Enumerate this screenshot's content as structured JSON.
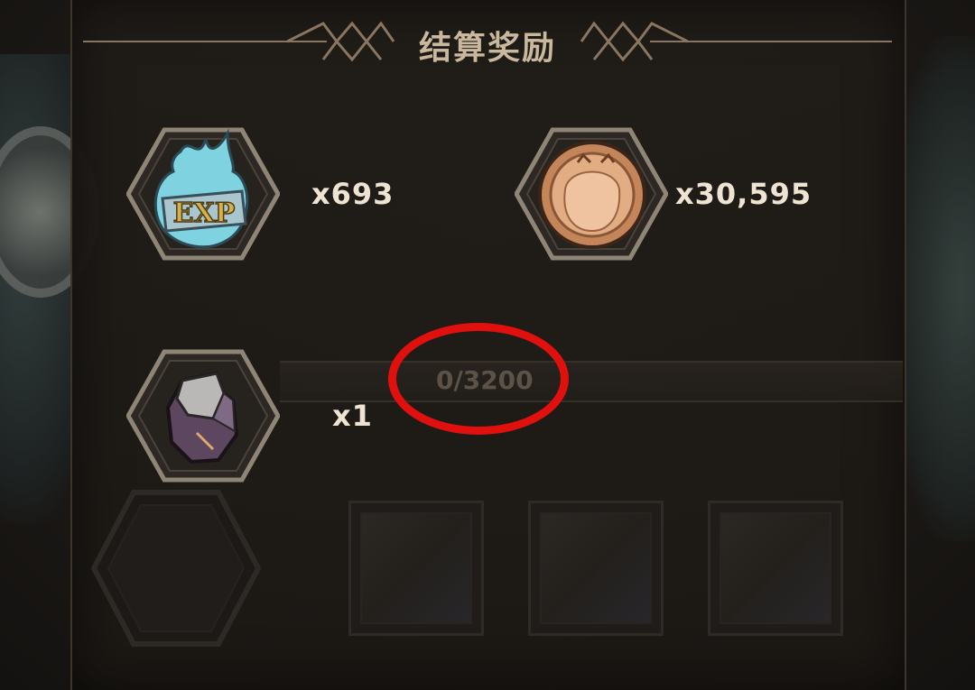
{
  "header": {
    "title": "结算奖励"
  },
  "rewards": [
    {
      "icon": "exp-orb-icon",
      "label": "EXP",
      "count": "x693"
    },
    {
      "icon": "gold-coin-icon",
      "count": "x30,595"
    },
    {
      "icon": "ore-crystal-icon",
      "count": "x1"
    }
  ],
  "progress": {
    "text": "0/3200",
    "current": 0,
    "max": 3200
  },
  "colors": {
    "accent": "#c9b79e",
    "annotation": "#e0100f",
    "count_text": "#efe4d3"
  }
}
